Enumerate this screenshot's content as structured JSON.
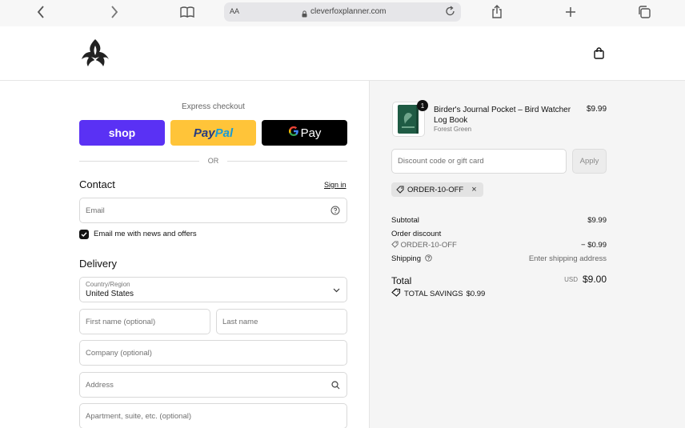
{
  "browser": {
    "text_size_label": "AA",
    "url": "cleverfoxplanner.com"
  },
  "express": {
    "title": "Express checkout",
    "shop_label": "shop",
    "paypal_label_pay": "Pay",
    "paypal_label_pal": "Pal",
    "gpay_label": "Pay",
    "or_label": "OR"
  },
  "contact": {
    "title": "Contact",
    "sign_in": "Sign in",
    "email_placeholder": "Email",
    "newsletter_label": "Email me with news and offers"
  },
  "delivery": {
    "title": "Delivery",
    "country_label": "Country/Region",
    "country_value": "United States",
    "first_name_placeholder": "First name (optional)",
    "last_name_placeholder": "Last name",
    "company_placeholder": "Company (optional)",
    "address_placeholder": "Address",
    "apartment_placeholder": "Apartment, suite, etc. (optional)"
  },
  "summary": {
    "product": {
      "quantity": "1",
      "name": "Birder's Journal Pocket – Bird Watcher Log Book",
      "variant": "Forest Green",
      "price": "$9.99"
    },
    "discount_placeholder": "Discount code or gift card",
    "apply_label": "Apply",
    "applied_code": "ORDER-10-OFF",
    "subtotal_label": "Subtotal",
    "subtotal_value": "$9.99",
    "order_discount_label": "Order discount",
    "order_discount_code": "ORDER-10-OFF",
    "order_discount_value": "− $0.99",
    "shipping_label": "Shipping",
    "shipping_value": "Enter shipping address",
    "total_label": "Total",
    "total_currency": "USD",
    "total_value": "$9.00",
    "savings_label": "TOTAL SAVINGS",
    "savings_value": "$0.99"
  },
  "colors": {
    "shop_purple": "#5a31f4",
    "paypal_yellow": "#ffc439",
    "paypal_dark_blue": "#253b80",
    "paypal_light_blue": "#179bd7",
    "gpay_black": "#000000",
    "summary_bg": "#f5f5f5"
  }
}
